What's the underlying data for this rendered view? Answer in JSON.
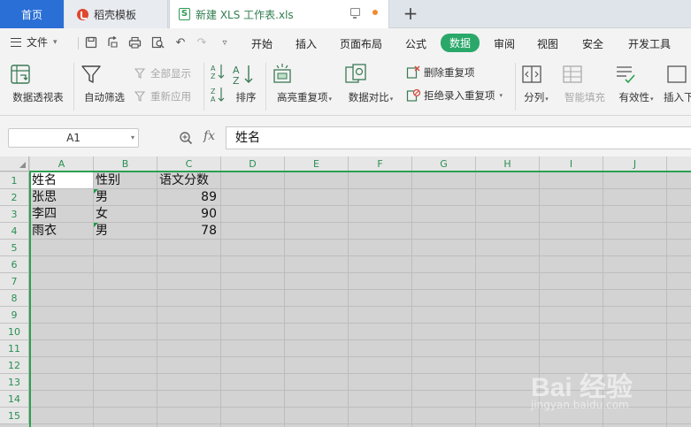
{
  "tabs": {
    "home": "首页",
    "templates": "稻壳模板",
    "document": "新建 XLS 工作表.xls"
  },
  "menu": {
    "file": "文件",
    "items": [
      "开始",
      "插入",
      "页面布局",
      "公式",
      "数据",
      "审阅",
      "视图",
      "安全",
      "开发工具"
    ],
    "active": "数据"
  },
  "ribbon": {
    "pivot": "数据透视表",
    "autofilter": "自动筛选",
    "show_all": "全部显示",
    "reapply": "重新应用",
    "sort": "排序",
    "highlight_dup": "高亮重复项",
    "compare": "数据对比",
    "remove_dup": "删除重复项",
    "reject_dup": "拒绝录入重复项",
    "split": "分列",
    "smart_fill": "智能填充",
    "validity": "有效性",
    "insert_more": "插入下"
  },
  "formula_bar": {
    "name_box": "A1",
    "fx": "fx",
    "value": "姓名"
  },
  "sheet": {
    "columns": [
      "A",
      "B",
      "C",
      "D",
      "E",
      "F",
      "G",
      "H",
      "I",
      "J"
    ],
    "rows": [
      "1",
      "2",
      "3",
      "4",
      "5",
      "6",
      "7",
      "8",
      "9",
      "10",
      "11",
      "12",
      "13",
      "14",
      "15"
    ],
    "cells": [
      [
        "姓名",
        "性别",
        "语文分数"
      ],
      [
        "张思",
        "男",
        "89"
      ],
      [
        "李四",
        "女",
        "90"
      ],
      [
        "雨衣",
        "男",
        "78"
      ]
    ]
  },
  "watermark": {
    "main": "Bai 经验",
    "sub": "jingyan.baidu.com"
  },
  "colors": {
    "accent_green": "#2aa86a",
    "home_tab_blue": "#2a6fd6",
    "selection_green": "#2aa14f"
  }
}
